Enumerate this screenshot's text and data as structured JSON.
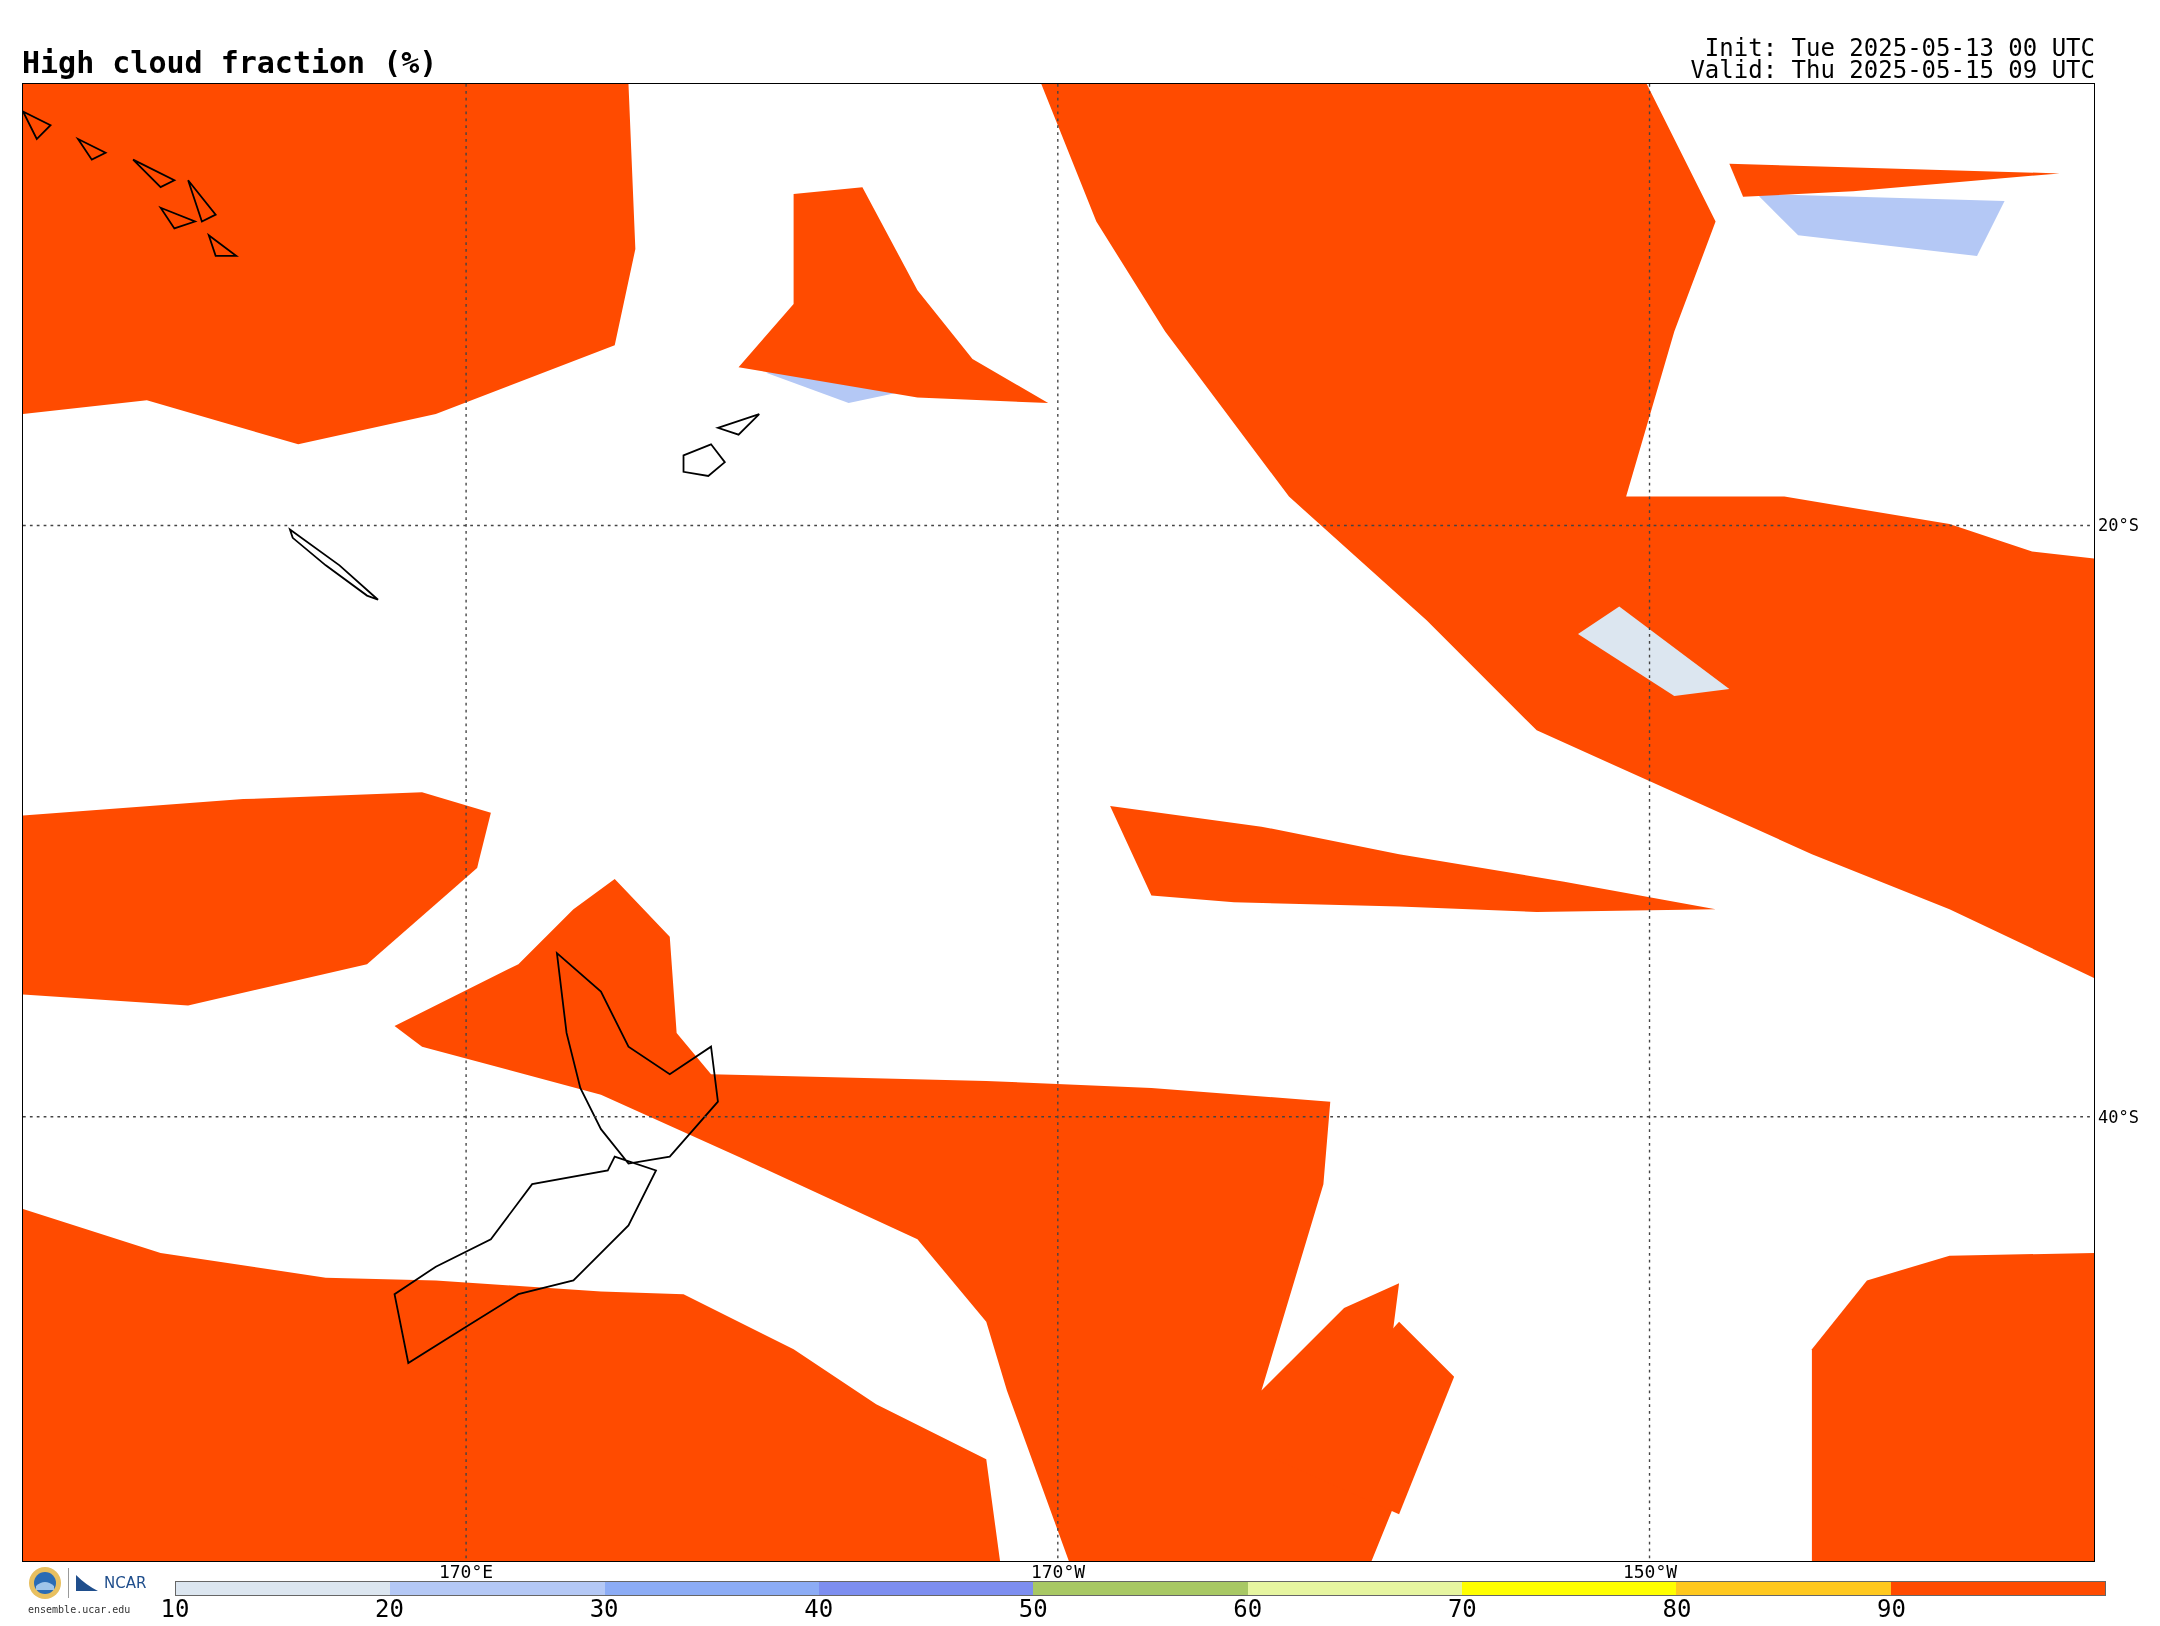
{
  "header": {
    "title": "High cloud fraction (%)",
    "init": "Init: Tue 2025-05-13 00 UTC",
    "valid": "Valid: Thu 2025-05-15 09 UTC"
  },
  "map": {
    "lat_labels": [
      "20°S",
      "40°S"
    ],
    "lon_labels": [
      "170°E",
      "170°W",
      "150°W"
    ]
  },
  "footer": {
    "logo_text": "NCAR",
    "site": "ensemble.ucar.edu"
  },
  "colorbar": {
    "bins": [
      {
        "color": "#dce6f0"
      },
      {
        "color": "#b4c8f5"
      },
      {
        "color": "#8cacf5"
      },
      {
        "color": "#7d8ef0"
      },
      {
        "color": "#a8c864"
      },
      {
        "color": "#e6f5a0"
      },
      {
        "color": "#ffff00"
      },
      {
        "color": "#ffc81e"
      },
      {
        "color": "#ff4b00"
      }
    ],
    "ticks": [
      "10",
      "20",
      "30",
      "40",
      "50",
      "60",
      "70",
      "80",
      "90"
    ]
  }
}
